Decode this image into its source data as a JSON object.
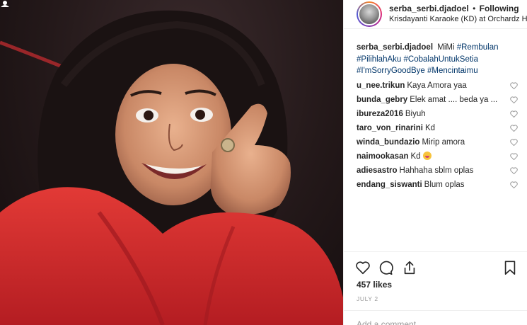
{
  "header": {
    "username": "serba_serbi.djadoel",
    "separator": "•",
    "follow_status": "Following",
    "location": "Krisdayanti Karaoke (KD) at Orchardz Hotel"
  },
  "caption": {
    "user": "serba_serbi.djadoel",
    "text": "MiMi",
    "hashtags": [
      "#Rembulan",
      "#PilihlahAku",
      "#CobalahUntukSetia",
      "#I'mSorryGoodBye",
      "#Mencintaimu"
    ]
  },
  "comments": [
    {
      "user": "u_nee.trikun",
      "text": "Kaya Amora yaa"
    },
    {
      "user": "bunda_gebry",
      "text": "Elek amat .... beda ya ..."
    },
    {
      "user": "ibureza2016",
      "text": "Biyuh"
    },
    {
      "user": "taro_von_rinarini",
      "text": "Kd"
    },
    {
      "user": "winda_bundazio",
      "text": "Mirip amora"
    },
    {
      "user": "naimookasan",
      "text": "Kd",
      "emoji": "grinning-face"
    },
    {
      "user": "adiesastro",
      "text": "Hahhaha sblm oplas"
    },
    {
      "user": "endang_siswanti",
      "text": "Blum oplas"
    }
  ],
  "actions": [
    "heart-icon",
    "comment-icon",
    "share-icon",
    "bookmark-icon"
  ],
  "likes": "457 likes",
  "date": "JULY 2",
  "comment_input": {
    "placeholder": "Add a comment..."
  },
  "colors": {
    "hashtag": "#003569",
    "text": "#262626",
    "muted": "#999999",
    "jacket": "#d42a2a"
  }
}
